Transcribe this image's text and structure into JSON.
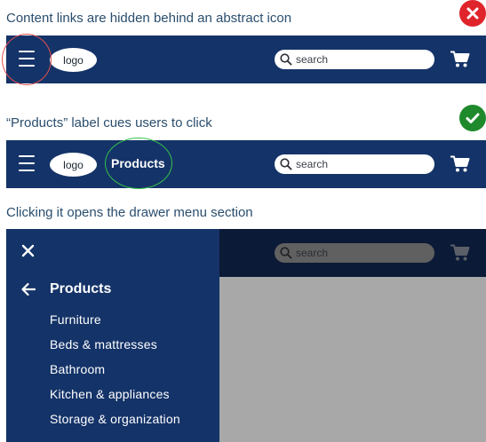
{
  "sections": [
    {
      "caption": "Content links are hidden behind an abstract icon",
      "status": "bad",
      "status_color": "#e0242c",
      "status_icon": "x-icon",
      "navbar": {
        "menu_icon": "hamburger-icon",
        "logo": "logo",
        "search_placeholder": "search",
        "cart_icon": "cart-icon",
        "highlight_color": "#e35050"
      }
    },
    {
      "caption": "“Products” label cues users to click",
      "status": "good",
      "status_color": "#1f8a2c",
      "status_icon": "checkmark-icon",
      "navbar": {
        "menu_icon": "hamburger-icon",
        "logo": "logo",
        "products_label": "Products",
        "search_placeholder": "search",
        "cart_icon": "cart-icon",
        "highlight_color": "#35c24a"
      }
    },
    {
      "caption": "Clicking it opens the drawer menu section",
      "navbar": {
        "search_placeholder": "search",
        "cart_icon": "cart-icon"
      },
      "drawer": {
        "close_icon": "close-icon",
        "back_icon": "back-arrow-icon",
        "title": "Products",
        "items": [
          "Furniture",
          "Beds & mattresses",
          "Bathroom",
          "Kitchen & appliances",
          "Storage & organization"
        ]
      }
    }
  ],
  "colors": {
    "navbar": "#143368",
    "overlay_navbar": "#0b1a36",
    "overlay_page": "#a8a8a8",
    "caption_text": "#2a4e6e"
  }
}
